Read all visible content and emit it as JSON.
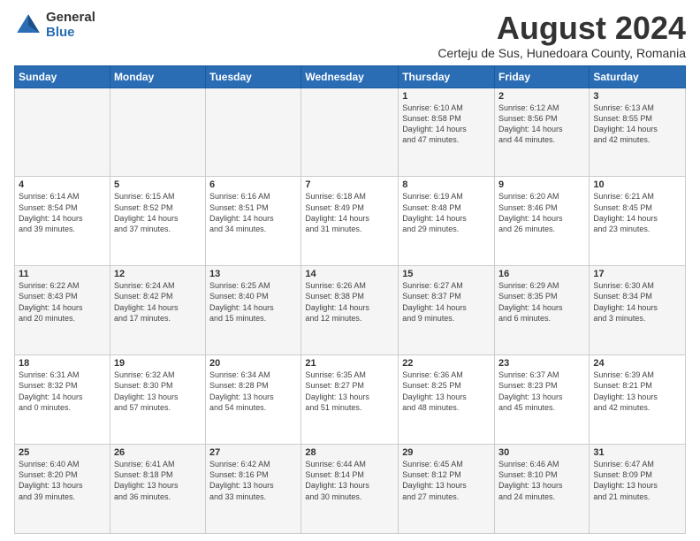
{
  "logo": {
    "general": "General",
    "blue": "Blue"
  },
  "title": "August 2024",
  "subtitle": "Certeju de Sus, Hunedoara County, Romania",
  "days_header": [
    "Sunday",
    "Monday",
    "Tuesday",
    "Wednesday",
    "Thursday",
    "Friday",
    "Saturday"
  ],
  "weeks": [
    [
      {
        "day": "",
        "info": ""
      },
      {
        "day": "",
        "info": ""
      },
      {
        "day": "",
        "info": ""
      },
      {
        "day": "",
        "info": ""
      },
      {
        "day": "1",
        "info": "Sunrise: 6:10 AM\nSunset: 8:58 PM\nDaylight: 14 hours\nand 47 minutes."
      },
      {
        "day": "2",
        "info": "Sunrise: 6:12 AM\nSunset: 8:56 PM\nDaylight: 14 hours\nand 44 minutes."
      },
      {
        "day": "3",
        "info": "Sunrise: 6:13 AM\nSunset: 8:55 PM\nDaylight: 14 hours\nand 42 minutes."
      }
    ],
    [
      {
        "day": "4",
        "info": "Sunrise: 6:14 AM\nSunset: 8:54 PM\nDaylight: 14 hours\nand 39 minutes."
      },
      {
        "day": "5",
        "info": "Sunrise: 6:15 AM\nSunset: 8:52 PM\nDaylight: 14 hours\nand 37 minutes."
      },
      {
        "day": "6",
        "info": "Sunrise: 6:16 AM\nSunset: 8:51 PM\nDaylight: 14 hours\nand 34 minutes."
      },
      {
        "day": "7",
        "info": "Sunrise: 6:18 AM\nSunset: 8:49 PM\nDaylight: 14 hours\nand 31 minutes."
      },
      {
        "day": "8",
        "info": "Sunrise: 6:19 AM\nSunset: 8:48 PM\nDaylight: 14 hours\nand 29 minutes."
      },
      {
        "day": "9",
        "info": "Sunrise: 6:20 AM\nSunset: 8:46 PM\nDaylight: 14 hours\nand 26 minutes."
      },
      {
        "day": "10",
        "info": "Sunrise: 6:21 AM\nSunset: 8:45 PM\nDaylight: 14 hours\nand 23 minutes."
      }
    ],
    [
      {
        "day": "11",
        "info": "Sunrise: 6:22 AM\nSunset: 8:43 PM\nDaylight: 14 hours\nand 20 minutes."
      },
      {
        "day": "12",
        "info": "Sunrise: 6:24 AM\nSunset: 8:42 PM\nDaylight: 14 hours\nand 17 minutes."
      },
      {
        "day": "13",
        "info": "Sunrise: 6:25 AM\nSunset: 8:40 PM\nDaylight: 14 hours\nand 15 minutes."
      },
      {
        "day": "14",
        "info": "Sunrise: 6:26 AM\nSunset: 8:38 PM\nDaylight: 14 hours\nand 12 minutes."
      },
      {
        "day": "15",
        "info": "Sunrise: 6:27 AM\nSunset: 8:37 PM\nDaylight: 14 hours\nand 9 minutes."
      },
      {
        "day": "16",
        "info": "Sunrise: 6:29 AM\nSunset: 8:35 PM\nDaylight: 14 hours\nand 6 minutes."
      },
      {
        "day": "17",
        "info": "Sunrise: 6:30 AM\nSunset: 8:34 PM\nDaylight: 14 hours\nand 3 minutes."
      }
    ],
    [
      {
        "day": "18",
        "info": "Sunrise: 6:31 AM\nSunset: 8:32 PM\nDaylight: 14 hours\nand 0 minutes."
      },
      {
        "day": "19",
        "info": "Sunrise: 6:32 AM\nSunset: 8:30 PM\nDaylight: 13 hours\nand 57 minutes."
      },
      {
        "day": "20",
        "info": "Sunrise: 6:34 AM\nSunset: 8:28 PM\nDaylight: 13 hours\nand 54 minutes."
      },
      {
        "day": "21",
        "info": "Sunrise: 6:35 AM\nSunset: 8:27 PM\nDaylight: 13 hours\nand 51 minutes."
      },
      {
        "day": "22",
        "info": "Sunrise: 6:36 AM\nSunset: 8:25 PM\nDaylight: 13 hours\nand 48 minutes."
      },
      {
        "day": "23",
        "info": "Sunrise: 6:37 AM\nSunset: 8:23 PM\nDaylight: 13 hours\nand 45 minutes."
      },
      {
        "day": "24",
        "info": "Sunrise: 6:39 AM\nSunset: 8:21 PM\nDaylight: 13 hours\nand 42 minutes."
      }
    ],
    [
      {
        "day": "25",
        "info": "Sunrise: 6:40 AM\nSunset: 8:20 PM\nDaylight: 13 hours\nand 39 minutes."
      },
      {
        "day": "26",
        "info": "Sunrise: 6:41 AM\nSunset: 8:18 PM\nDaylight: 13 hours\nand 36 minutes."
      },
      {
        "day": "27",
        "info": "Sunrise: 6:42 AM\nSunset: 8:16 PM\nDaylight: 13 hours\nand 33 minutes."
      },
      {
        "day": "28",
        "info": "Sunrise: 6:44 AM\nSunset: 8:14 PM\nDaylight: 13 hours\nand 30 minutes."
      },
      {
        "day": "29",
        "info": "Sunrise: 6:45 AM\nSunset: 8:12 PM\nDaylight: 13 hours\nand 27 minutes."
      },
      {
        "day": "30",
        "info": "Sunrise: 6:46 AM\nSunset: 8:10 PM\nDaylight: 13 hours\nand 24 minutes."
      },
      {
        "day": "31",
        "info": "Sunrise: 6:47 AM\nSunset: 8:09 PM\nDaylight: 13 hours\nand 21 minutes."
      }
    ]
  ]
}
